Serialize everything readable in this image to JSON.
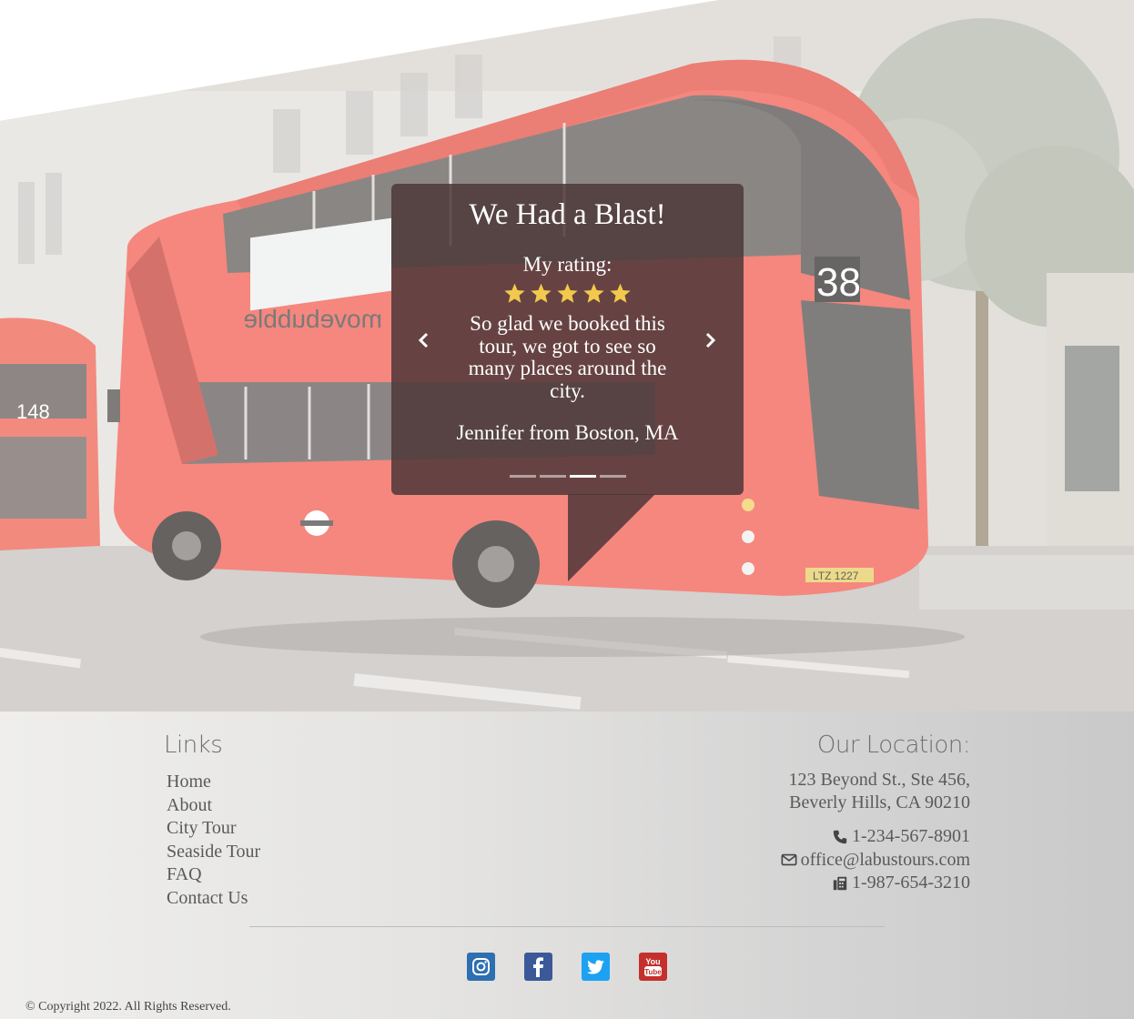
{
  "testimonial": {
    "title": "We Had a Blast!",
    "rating_label": "My rating:",
    "rating_value": 5,
    "rating_max": 5,
    "quote": "So glad we booked this tour, we got to see so many places around the city.",
    "author": "Jennifer from Boston, MA",
    "slide_count": 4,
    "active_slide": 3
  },
  "bus": {
    "route_number": "38",
    "other_bus_number": "148",
    "ad_text": "movebubble",
    "plate": "LTZ 1227"
  },
  "footer": {
    "links_heading": "Links",
    "links": [
      "Home",
      "About",
      "City Tour",
      "Seaside Tour",
      "FAQ",
      "Contact Us"
    ],
    "location_heading": "Our Location:",
    "address_line1": "123 Beyond St., Ste 456,",
    "address_line2": "Beverly Hills, CA 90210",
    "phone": "1-234-567-8901",
    "email": "office@labustours.com",
    "fax": "1-987-654-3210",
    "social": [
      "instagram-icon",
      "facebook-icon",
      "twitter-icon",
      "youtube-icon"
    ],
    "copyright": "© Copyright 2022. All Rights Reserved."
  },
  "colors": {
    "card_bg": "#4e3838",
    "star": "#f2c94c",
    "instagram": "#2d6fb0",
    "facebook": "#3b5998",
    "twitter": "#1da1f2",
    "youtube": "#c4302b"
  }
}
